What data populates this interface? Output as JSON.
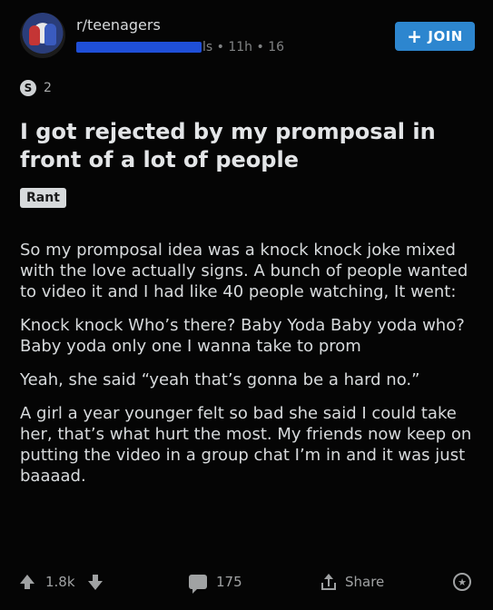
{
  "header": {
    "subreddit": "r/teenagers",
    "meta_visible": "ls • 11h • 16",
    "join_label": "JOIN"
  },
  "award": {
    "count": "2",
    "icon_name": "award-s-icon"
  },
  "post": {
    "title": "I got rejected by my promposal in front of a lot of people",
    "flair": "Rant",
    "paragraphs": [
      "So my promposal idea was a knock knock joke mixed with the love actually signs. A bunch of people wanted to video it and I had like 40 people watching, It went:",
      "Knock knock Who’s there? Baby Yoda Baby yoda who? Baby yoda only one I wanna take to prom",
      "Yeah, she said “yeah that’s gonna be a hard no.”",
      "A girl a year younger felt so bad she said I could take her, that’s what hurt the most. My friends now keep on putting the video in a group chat I’m in and it was just baaaad."
    ]
  },
  "footer": {
    "votes": "1.8k",
    "comments": "175",
    "share_label": "Share"
  },
  "colors": {
    "background": "#050505",
    "join_button": "#2d86cf",
    "text": "#d7dadc",
    "muted": "#818384"
  }
}
